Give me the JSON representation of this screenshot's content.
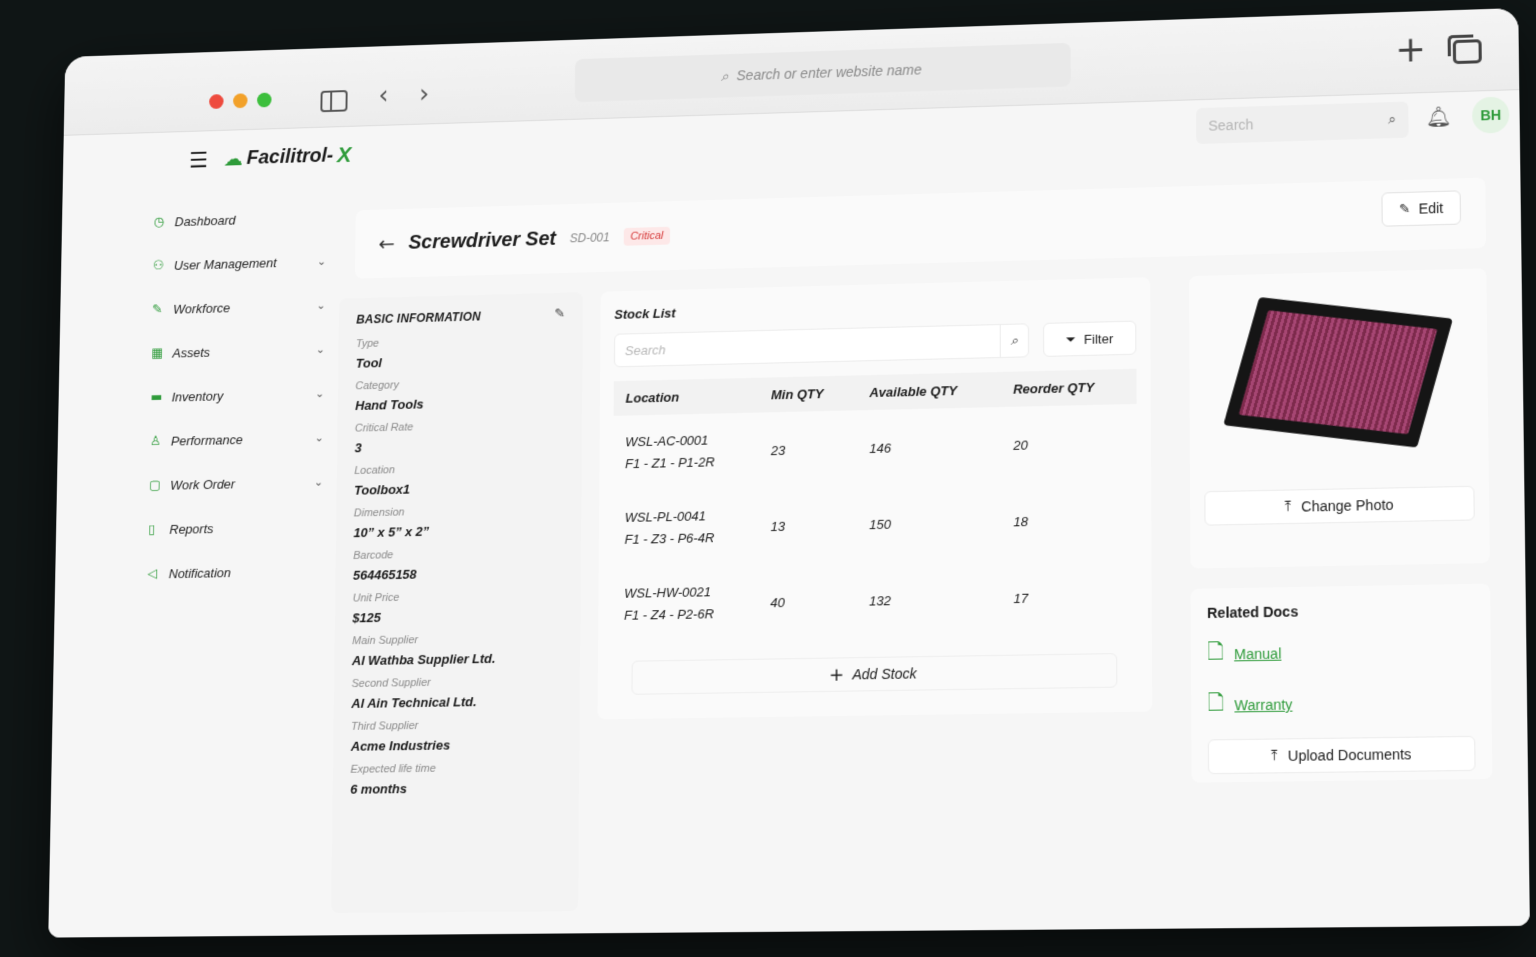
{
  "browser": {
    "address_placeholder": "Search or enter website name"
  },
  "app": {
    "logo_text": "Facilitrol-",
    "logo_x": "X",
    "search_placeholder": "Search",
    "avatar_initials": "BH"
  },
  "sidebar": {
    "items": [
      {
        "label": "Dashboard",
        "icon": "dashboard-icon",
        "has_chevron": false
      },
      {
        "label": "User Management",
        "icon": "user-icon",
        "has_chevron": true
      },
      {
        "label": "Workforce",
        "icon": "wrench-icon",
        "has_chevron": true
      },
      {
        "label": "Assets",
        "icon": "grid-icon",
        "has_chevron": true
      },
      {
        "label": "Inventory",
        "icon": "box-icon",
        "has_chevron": true
      },
      {
        "label": "Performance",
        "icon": "performance-icon",
        "has_chevron": true
      },
      {
        "label": "Work Order",
        "icon": "clipboard-icon",
        "has_chevron": true
      },
      {
        "label": "Reports",
        "icon": "document-icon",
        "has_chevron": false
      },
      {
        "label": "Notification",
        "icon": "megaphone-icon",
        "has_chevron": false
      }
    ]
  },
  "header": {
    "title": "Screwdriver Set",
    "code": "SD-001",
    "badge": "Critical",
    "edit_label": "Edit"
  },
  "basic_info": {
    "heading": "BASIC INFORMATION",
    "fields": [
      {
        "label": "Type",
        "value": "Tool"
      },
      {
        "label": "Category",
        "value": "Hand Tools"
      },
      {
        "label": "Critical Rate",
        "value": "3"
      },
      {
        "label": "Location",
        "value": "Toolbox1"
      },
      {
        "label": "Dimension",
        "value": "10” x 5” x 2”"
      },
      {
        "label": "Barcode",
        "value": "564465158"
      },
      {
        "label": "Unit Price",
        "value": "$125"
      },
      {
        "label": "Main Supplier",
        "value": "Al Wathba Supplier Ltd."
      },
      {
        "label": "Second Supplier",
        "value": "Al Ain Technical Ltd."
      },
      {
        "label": "Third Supplier",
        "value": "Acme Industries"
      },
      {
        "label": "Expected life time",
        "value": "6 months"
      }
    ]
  },
  "stock_list": {
    "heading": "Stock List",
    "search_placeholder": "Search",
    "filter_label": "Filter",
    "columns": [
      "Location",
      "Min QTY",
      "Available QTY",
      "Reorder QTY"
    ],
    "rows": [
      {
        "location_code": "WSL-AC-0001",
        "location_path": "F1 - Z1 - P1-2R",
        "min": "23",
        "available": "146",
        "reorder": "20"
      },
      {
        "location_code": "WSL-PL-0041",
        "location_path": "F1 - Z3 - P6-4R",
        "min": "13",
        "available": "150",
        "reorder": "18"
      },
      {
        "location_code": "WSL-HW-0021",
        "location_path": "F1 - Z4 - P2-6R",
        "min": "40",
        "available": "132",
        "reorder": "17"
      }
    ],
    "add_label": "Add Stock"
  },
  "photo": {
    "change_label": "Change Photo"
  },
  "related_docs": {
    "heading": "Related Docs",
    "docs": [
      "Manual",
      "Warranty"
    ],
    "upload_label": "Upload Documents"
  },
  "colors": {
    "brand_green": "#2e9b3a",
    "critical_red": "#d63a3a"
  }
}
